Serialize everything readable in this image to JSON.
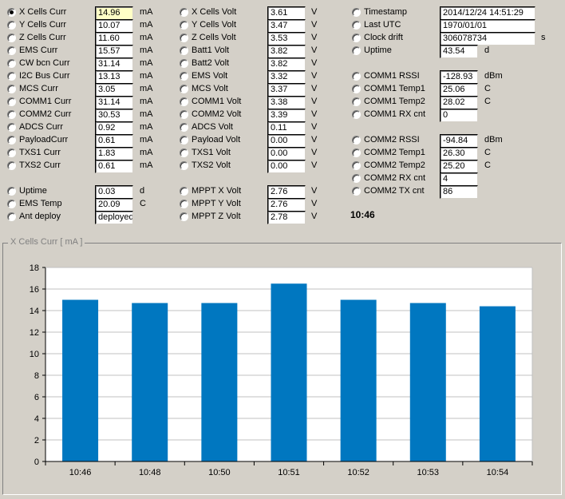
{
  "colors": {
    "bar": "#0077c0",
    "plot_bg": "#ffffff",
    "grid": "#c0c0c0"
  },
  "col1": [
    {
      "label": "X Cells Curr",
      "value": "14.96",
      "unit": "mA",
      "checked": true,
      "selected": true
    },
    {
      "label": "Y Cells Curr",
      "value": "10.07",
      "unit": "mA"
    },
    {
      "label": "Z Cells Curr",
      "value": "11.60",
      "unit": "mA"
    },
    {
      "label": "EMS Curr",
      "value": "15.57",
      "unit": "mA"
    },
    {
      "label": "CW bcn Curr",
      "value": "31.14",
      "unit": "mA"
    },
    {
      "label": "I2C Bus Curr",
      "value": "13.13",
      "unit": "mA"
    },
    {
      "label": "MCS Curr",
      "value": "3.05",
      "unit": "mA"
    },
    {
      "label": "COMM1 Curr",
      "value": "31.14",
      "unit": "mA"
    },
    {
      "label": "COMM2 Curr",
      "value": "30.53",
      "unit": "mA"
    },
    {
      "label": "ADCS Curr",
      "value": "0.92",
      "unit": "mA"
    },
    {
      "label": "PayloadCurr",
      "value": "0.61",
      "unit": "mA"
    },
    {
      "label": "TXS1 Curr",
      "value": "1.83",
      "unit": "mA"
    },
    {
      "label": "TXS2 Curr",
      "value": "0.61",
      "unit": "mA"
    }
  ],
  "col1b": [
    {
      "label": "Uptime",
      "value": "0.03",
      "unit": "d"
    },
    {
      "label": "EMS Temp",
      "value": "20.09",
      "unit": "C"
    },
    {
      "label": "Ant deploy",
      "value": "deployed",
      "unit": ""
    }
  ],
  "col2": [
    {
      "label": "X Cells Volt",
      "value": "3.61",
      "unit": "V"
    },
    {
      "label": "Y Cells Volt",
      "value": "3.47",
      "unit": "V"
    },
    {
      "label": "Z Cells Volt",
      "value": "3.53",
      "unit": "V"
    },
    {
      "label": "Batt1 Volt",
      "value": "3.82",
      "unit": "V"
    },
    {
      "label": "Batt2 Volt",
      "value": "3.82",
      "unit": "V"
    },
    {
      "label": "EMS Volt",
      "value": "3.32",
      "unit": "V"
    },
    {
      "label": "MCS Volt",
      "value": "3.37",
      "unit": "V"
    },
    {
      "label": "COMM1 Volt",
      "value": "3.38",
      "unit": "V"
    },
    {
      "label": "COMM2 Volt",
      "value": "3.39",
      "unit": "V"
    },
    {
      "label": "ADCS Volt",
      "value": "0.11",
      "unit": "V"
    },
    {
      "label": "Payload Volt",
      "value": "0.00",
      "unit": "V"
    },
    {
      "label": "TXS1 Volt",
      "value": "0.00",
      "unit": "V"
    },
    {
      "label": "TXS2 Volt",
      "value": "0.00",
      "unit": "V"
    }
  ],
  "col2b": [
    {
      "label": "MPPT X Volt",
      "value": "2.76",
      "unit": "V"
    },
    {
      "label": "MPPT Y Volt",
      "value": "2.76",
      "unit": "V"
    },
    {
      "label": "MPPT Z Volt",
      "value": "2.78",
      "unit": "V"
    }
  ],
  "col3a": [
    {
      "label": "Timestamp",
      "value": "2014/12/24 14:51:29",
      "unit": ""
    },
    {
      "label": "Last UTC",
      "value": "1970/01/01",
      "unit": ""
    },
    {
      "label": "Clock drift",
      "value": "306078734",
      "unit": "s"
    },
    {
      "label": "Uptime",
      "value": "43.54",
      "unit": "d"
    }
  ],
  "col3b": [
    {
      "label": "COMM1 RSSI",
      "value": "-128.93",
      "unit": "dBm"
    },
    {
      "label": "COMM1 Temp1",
      "value": "25.06",
      "unit": "C"
    },
    {
      "label": "COMM1 Temp2",
      "value": "28.02",
      "unit": "C"
    },
    {
      "label": "COMM1 RX cnt",
      "value": "0",
      "unit": ""
    }
  ],
  "col3c": [
    {
      "label": "COMM2 RSSI",
      "value": "-94.84",
      "unit": "dBm"
    },
    {
      "label": "COMM2 Temp1",
      "value": "26.30",
      "unit": "C"
    },
    {
      "label": "COMM2 Temp2",
      "value": "25.20",
      "unit": "C"
    },
    {
      "label": "COMM2 RX cnt",
      "value": "4",
      "unit": ""
    },
    {
      "label": "COMM2 TX cnt",
      "value": "86",
      "unit": ""
    }
  ],
  "clock": "10:46",
  "chart_data": {
    "type": "bar",
    "title": "X Cells Curr  [ mA ]",
    "categories": [
      "10:46",
      "10:48",
      "10:50",
      "10:51",
      "10:52",
      "10:53",
      "10:54"
    ],
    "values": [
      15.0,
      14.7,
      14.7,
      16.5,
      15.0,
      14.7,
      14.4
    ],
    "ylim": [
      0,
      18
    ],
    "yticks": [
      0,
      2,
      4,
      6,
      8,
      10,
      12,
      14,
      16,
      18
    ],
    "xlabel": "",
    "ylabel": "",
    "grid": true,
    "legend": "none"
  }
}
